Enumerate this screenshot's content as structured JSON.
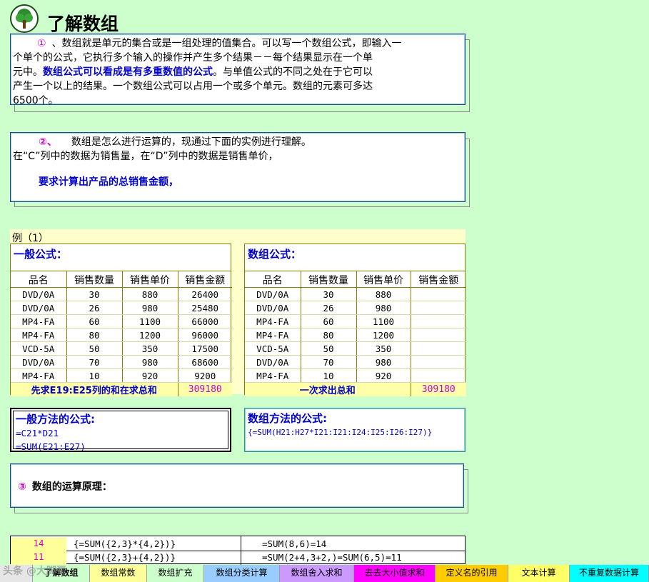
{
  "title": "了解数组",
  "notes": {
    "note1": {
      "marker": "①",
      "lines": [
        "、数组就是单元的集合或是一组处理的值集合。可以写一个数组公式，即输入一",
        "个单个的公式，它执行多个输入的操作并产生多个结果－－每个结果显示在一个单"
      ],
      "line3_pre": "元中。",
      "line3_emph": "数组公式可以看成是有多重数值的公式",
      "line3_post": "。与单值公式的不同之处在于它可以",
      "line4": "产生一个以上的结果。一个数组公式可以占用一个或多个单元。数组的元素可多达",
      "line5": "6500个。"
    },
    "note2": {
      "marker": "②、",
      "line1": "数组是怎么进行运算的，现通过下面的实例进行理解。",
      "line2": "在“C”列中的数据为销售量，在“D”列中的数据是销售单价，",
      "line3": "要求计算出产品的总销售金额，"
    },
    "note3": {
      "marker": "③",
      "text": "数组的运算原理："
    }
  },
  "example": {
    "label": "例（1）",
    "left": {
      "title": "一般公式：",
      "headers": [
        "品名",
        "销售数量",
        "销售单价",
        "销售金额"
      ],
      "rows": [
        [
          "DVD/0A",
          "30",
          "880",
          "26400"
        ],
        [
          "DVD/0A",
          "26",
          "980",
          "25480"
        ],
        [
          "MP4-FA",
          "60",
          "1100",
          "66000"
        ],
        [
          "MP4-FA",
          "80",
          "1200",
          "96000"
        ],
        [
          "VCD-5A",
          "50",
          "350",
          "17500"
        ],
        [
          "DVD/0A",
          "70",
          "980",
          "68600"
        ],
        [
          "MP4-FA",
          "10",
          "920",
          "9200"
        ]
      ],
      "total_label": "先求E19:E25列的和在求总和",
      "total_value": "309180"
    },
    "right": {
      "title": "数组公式：",
      "headers": [
        "品名",
        "销售数量",
        "销售单价",
        "销售金额"
      ],
      "rows": [
        [
          "DVD/0A",
          "30",
          "880",
          ""
        ],
        [
          "DVD/0A",
          "26",
          "980",
          ""
        ],
        [
          "MP4-FA",
          "60",
          "1100",
          ""
        ],
        [
          "MP4-FA",
          "80",
          "1200",
          ""
        ],
        [
          "VCD-5A",
          "50",
          "350",
          ""
        ],
        [
          "DVD/0A",
          "70",
          "980",
          ""
        ],
        [
          "MP4-FA",
          "10",
          "920",
          ""
        ]
      ],
      "total_label": "一次求出总和",
      "total_value": "309180"
    }
  },
  "formulas": {
    "general_title": "一般方法的公式:",
    "general_lines": [
      "=C21*D21",
      "=SUM(E21:E27)"
    ],
    "array_title": "数组方法的公式:",
    "array_line": "{=SUM(H21:H27*I21:I21:I24:I25:I26:I27)}"
  },
  "bottom_rows": [
    {
      "num": "14",
      "formula": "{=SUM({2,3}*{4,2})}",
      "explain": "=SUM(8,6)=14"
    },
    {
      "num": "11",
      "formula": "{=SUM({2,3}+{4,2})}",
      "explain": "=SUM(2+4,3+2,)=SUM(6,5)=11"
    }
  ],
  "sheet_tabs": [
    {
      "label": "了解数组",
      "color": "#ccffcc",
      "active": true
    },
    {
      "label": "数组常数",
      "color": "#ffff99",
      "active": false
    },
    {
      "label": "数组扩充",
      "color": "#ccffcc",
      "active": false
    },
    {
      "label": "数组分类计算",
      "color": "#99ccff",
      "active": false
    },
    {
      "label": "数组舍入求和",
      "color": "#cc99ff",
      "active": false
    },
    {
      "label": "去去大小值求和",
      "color": "#ff00ff",
      "active": false
    },
    {
      "label": "定义名的引用",
      "color": "#ffcc00",
      "active": false
    },
    {
      "label": "文本计算",
      "color": "#ffff66",
      "active": false
    },
    {
      "label": "不重复数据计算",
      "color": "#00ffff",
      "active": false
    }
  ],
  "watermark": "头条 @大脚哥"
}
